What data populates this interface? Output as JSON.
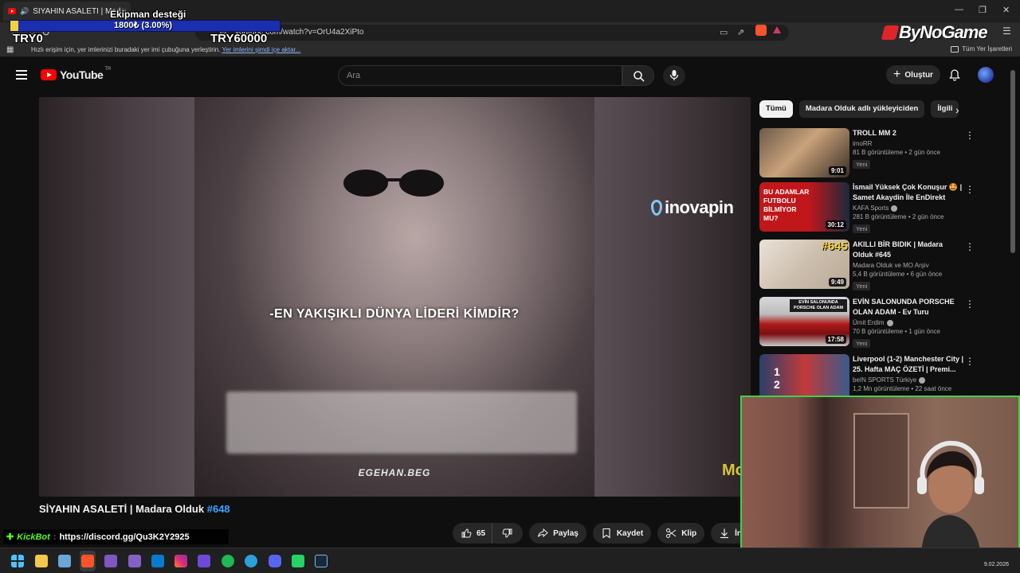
{
  "browser": {
    "tab_title": "SİYAHIN ASALETİ | Madara O...",
    "url": "youtube.com/watch?v=OrU4a2XiPto",
    "bookmarks_hint": "Hızlı erişim için, yer imlerinizi buradaki yer imi çubuğuna yerleştirin.",
    "bookmarks_link": "Yer imlerini şimdi içe aktar...",
    "bookmarks_all": "Tüm Yer İşaretleri"
  },
  "youtube": {
    "logo_text": "YouTube",
    "logo_region": "TR",
    "search_placeholder": "Ara",
    "create_label": "Oluştur"
  },
  "player": {
    "caption": "-EN YAKIŞIKLI DÜNYA LİDERİ KİMDİR?",
    "watermark": "EGEHAN.BEG",
    "sponsor": "inovapin",
    "mo_mark": "Mo"
  },
  "video": {
    "title": "SİYAHIN ASALETİ | Madara Olduk",
    "tag": "#648",
    "actions": {
      "like_count": "65",
      "share": "Paylaş",
      "save": "Kaydet",
      "clip": "Klip",
      "download": "İndir"
    }
  },
  "chips": [
    "Tümü",
    "Madara Olduk adlı yükleyiciden",
    "İlgili"
  ],
  "recommendations": [
    {
      "title": "TROLL MM 2",
      "channel": "imoRR",
      "verified": false,
      "stats": "81 B görüntüleme • 2 gün önce",
      "badge": "Yeni",
      "duration": "9:01"
    },
    {
      "title": "İsmail Yüksek Çok Konuşur 🤩 | Samet Akaydin İle EnDirekt",
      "channel": "KAFA Sports",
      "verified": true,
      "stats": "281 B görüntüleme • 2 gün önce",
      "badge": "Yeni",
      "duration": "30:12",
      "thumb_text": "BU ADAMLAR FUTBOLU BİLMİYOR MU?"
    },
    {
      "title": "AKILLI BİR BIDIK | Madara Olduk #645",
      "channel": "Madara Olduk ve MO Arşiv",
      "verified": false,
      "stats": "5,4 B görüntüleme • 6 gün önce",
      "badge": "Yeni",
      "duration": "9:49",
      "thumb_text": "#645"
    },
    {
      "title": "EVİN SALONUNDA PORSCHE OLAN ADAM - Ev Turu",
      "channel": "Ümit Erdim",
      "verified": true,
      "stats": "70 B görüntüleme • 1 gün önce",
      "badge": "Yeni",
      "duration": "17:58",
      "thumb_text": "EVİN SALONUNDA PORSCHE OLAN ADAM"
    },
    {
      "title": "Liverpool (1-2) Manchester City | 25. Hafta MAÇ ÖZETİ | Premi...",
      "channel": "beIN SPORTS Türkiye",
      "verified": true,
      "stats": "1,2 Mn görüntüleme • 22 saat önce",
      "badge": "",
      "duration": ""
    }
  ],
  "overlay": {
    "goal_title": "Ekipman desteği",
    "goal_amount": "1800₺ (3.00%)",
    "goal_progress": 0.03,
    "goal_min": "TRY0",
    "goal_max": "TRY60000",
    "sponsor_logo": "ByNoGame",
    "kickbot_name": "KickBot",
    "kickbot_sep": ":",
    "kickbot_message": "https://discord.gg/Qu3K2Y2925"
  },
  "taskbar": {
    "date": "9.02.2026"
  },
  "colors": {
    "yt_red": "#ff0000",
    "link_blue": "#3ea6ff",
    "webcam_border": "#3fd14a",
    "goal_bar": "#1b2fae",
    "goal_fill": "#f4d03f",
    "kick_green": "#53fc18"
  }
}
